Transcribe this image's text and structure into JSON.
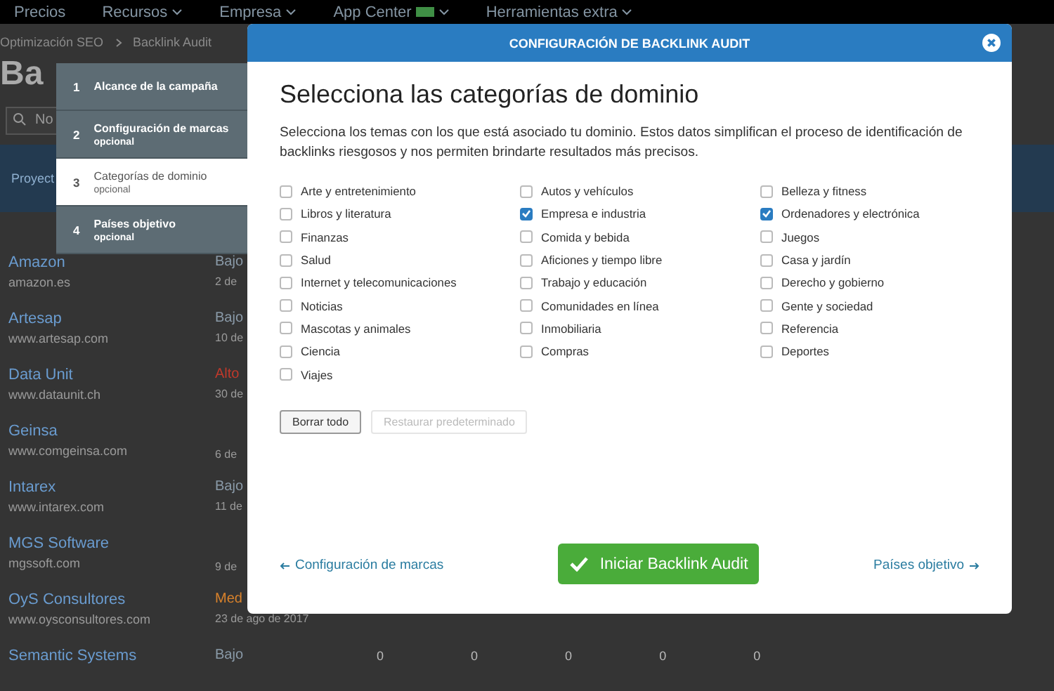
{
  "top_nav": {
    "items": [
      {
        "label": "Precios",
        "caret": false,
        "badge": false
      },
      {
        "label": "Recursos",
        "caret": true,
        "badge": false
      },
      {
        "label": "Empresa",
        "caret": true,
        "badge": false
      },
      {
        "label": "App Center",
        "caret": true,
        "badge": true
      },
      {
        "label": "Herramientas extra",
        "caret": true,
        "badge": false
      }
    ]
  },
  "breadcrumb": [
    "Optimización SEO",
    "Backlink Audit"
  ],
  "page_title": "Ba",
  "search": {
    "placeholder": "No"
  },
  "projects_tab": "Proyect",
  "projects": [
    {
      "name": "Amazon",
      "domain": "amazon.es",
      "risk": "Bajo",
      "color": "#8a9aa8",
      "date": "2 de"
    },
    {
      "name": "Artesap",
      "domain": "www.artesap.com",
      "risk": "Bajo",
      "color": "#8a9aa8",
      "date": "10 de"
    },
    {
      "name": "Data Unit",
      "domain": "www.dataunit.ch",
      "risk": "Alto",
      "color": "#c0392b",
      "date": "30 de"
    },
    {
      "name": "Geinsa",
      "domain": "www.comgeinsa.com",
      "date": "6 de"
    },
    {
      "name": "Intarex",
      "domain": "www.intarex.com",
      "risk": "Bajo",
      "color": "#8a9aa8",
      "date": "11 de"
    },
    {
      "name": "MGS Software",
      "domain": "mgssoft.com",
      "date": "9 de"
    },
    {
      "name": "OyS Consultores",
      "domain": "www.oysconsultores.com",
      "risk": "Med",
      "color": "#d9822b",
      "date": "23 de ago de 2017"
    },
    {
      "name": "Semantic Systems",
      "risk": "Bajo",
      "color": "#8a9aa8",
      "values": [
        "0",
        "0",
        "0",
        "0",
        "0"
      ]
    }
  ],
  "modal": {
    "title": "CONFIGURACIÓN DE BACKLINK AUDIT",
    "steps": [
      {
        "number": "1",
        "title": "Alcance de la campaña",
        "selected": false
      },
      {
        "number": "2",
        "title": "Configuración de marcas",
        "subtitle": "opcional",
        "selected": false
      },
      {
        "number": "3",
        "title": "Categorías de dominio",
        "subtitle": "opcional",
        "selected": true
      },
      {
        "number": "4",
        "title": "Países objetivo",
        "subtitle": "opcional",
        "selected": false
      }
    ],
    "heading": "Selecciona las categorías de dominio",
    "description": "Selecciona los temas con los que está asociado tu dominio. Estos datos simplifican el proceso de identificación de backlinks riesgosos y nos permiten brindarte resultados más precisos.",
    "categories": [
      [
        {
          "label": "Arte y entretenimiento",
          "checked": false
        },
        {
          "label": "Libros y literatura",
          "checked": false
        },
        {
          "label": "Finanzas",
          "checked": false
        },
        {
          "label": "Salud",
          "checked": false
        },
        {
          "label": "Internet y telecomunicaciones",
          "checked": false
        },
        {
          "label": "Noticias",
          "checked": false
        },
        {
          "label": "Mascotas y animales",
          "checked": false
        },
        {
          "label": "Ciencia",
          "checked": false
        },
        {
          "label": "Viajes",
          "checked": false
        }
      ],
      [
        {
          "label": "Autos y vehículos",
          "checked": false
        },
        {
          "label": "Empresa e industria",
          "checked": true
        },
        {
          "label": "Comida y bebida",
          "checked": false
        },
        {
          "label": "Aficiones y tiempo libre",
          "checked": false
        },
        {
          "label": "Trabajo y educación",
          "checked": false
        },
        {
          "label": "Comunidades en línea",
          "checked": false
        },
        {
          "label": "Inmobiliaria",
          "checked": false
        },
        {
          "label": "Compras",
          "checked": false
        }
      ],
      [
        {
          "label": "Belleza y fitness",
          "checked": false
        },
        {
          "label": "Ordenadores y electrónica",
          "checked": true
        },
        {
          "label": "Juegos",
          "checked": false
        },
        {
          "label": "Casa y jardín",
          "checked": false
        },
        {
          "label": "Derecho y gobierno",
          "checked": false
        },
        {
          "label": "Gente y sociedad",
          "checked": false
        },
        {
          "label": "Referencia",
          "checked": false
        },
        {
          "label": "Deportes",
          "checked": false
        }
      ]
    ],
    "buttons": [
      {
        "label": "Borrar todo",
        "disabled": false
      },
      {
        "label": "Restaurar predeterminado",
        "disabled": true
      }
    ],
    "back_link": "Configuración de marcas",
    "start_button": "Iniciar Backlink Audit",
    "next_link": "Países objetivo"
  }
}
